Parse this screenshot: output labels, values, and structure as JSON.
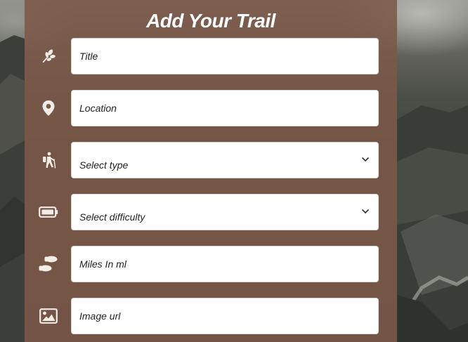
{
  "form": {
    "title": "Add Your Trail",
    "fields": [
      {
        "icon": "leaf-icon",
        "placeholder": "Title",
        "kind": "input"
      },
      {
        "icon": "map-pin-icon",
        "placeholder": "Location",
        "kind": "input"
      },
      {
        "icon": "hiker-icon",
        "value": "Select type",
        "kind": "select"
      },
      {
        "icon": "battery-icon",
        "value": "Select difficulty",
        "kind": "select"
      },
      {
        "icon": "footprints-icon",
        "placeholder": "Miles In ml",
        "kind": "input"
      },
      {
        "icon": "image-icon",
        "placeholder": "Image url",
        "kind": "input"
      }
    ]
  },
  "colors": {
    "panel": "#7c5848",
    "icon": "#f2ece6",
    "field_bg": "#ffffff"
  }
}
